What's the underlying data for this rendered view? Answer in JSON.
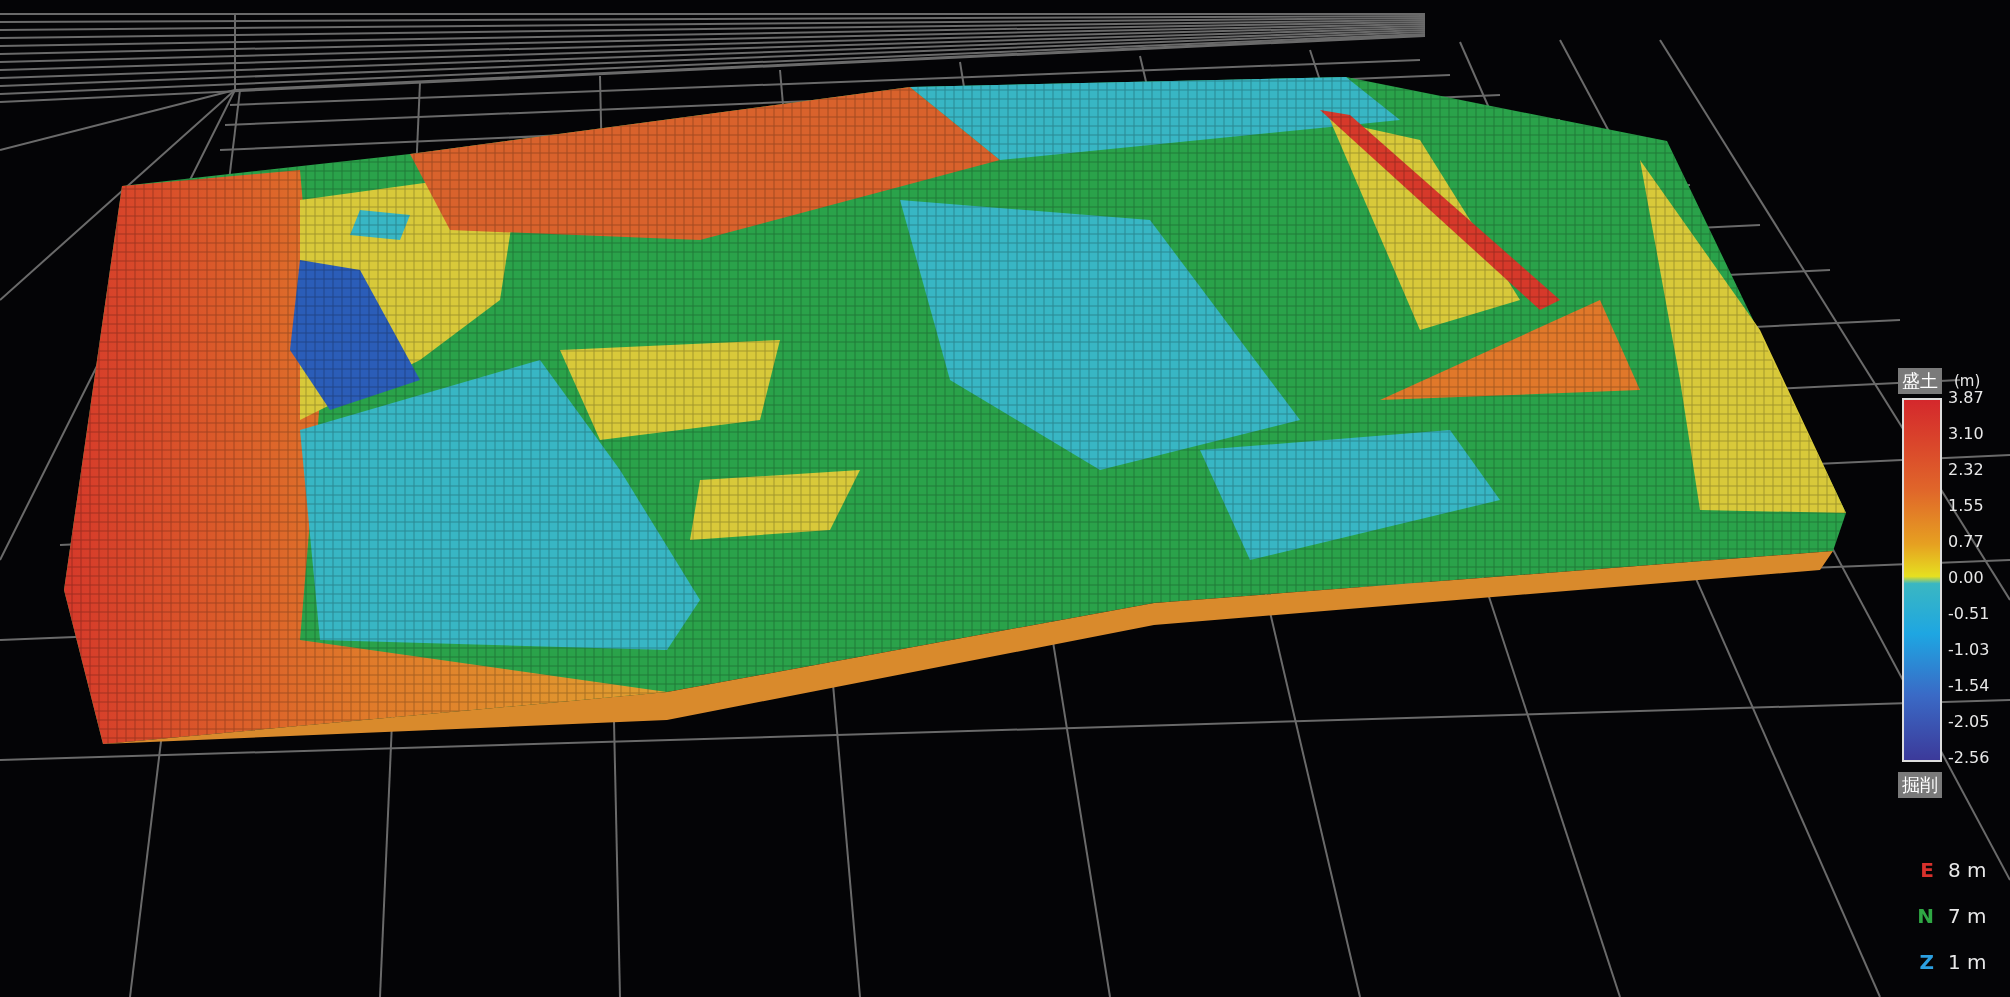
{
  "legend": {
    "top_label": "盛土",
    "unit": "(m)",
    "bottom_label": "掘削",
    "ticks": [
      "3.87",
      "3.10",
      "2.32",
      "1.55",
      "0.77",
      "0.00",
      "-0.51",
      "-1.03",
      "-1.54",
      "-2.05",
      "-2.56"
    ]
  },
  "scale": [
    {
      "axis": "E",
      "value": "8 m",
      "color": "#d8312c"
    },
    {
      "axis": "N",
      "value": "7 m",
      "color": "#2fa844"
    },
    {
      "axis": "Z",
      "value": "1 m",
      "color": "#2c9fe0"
    }
  ]
}
